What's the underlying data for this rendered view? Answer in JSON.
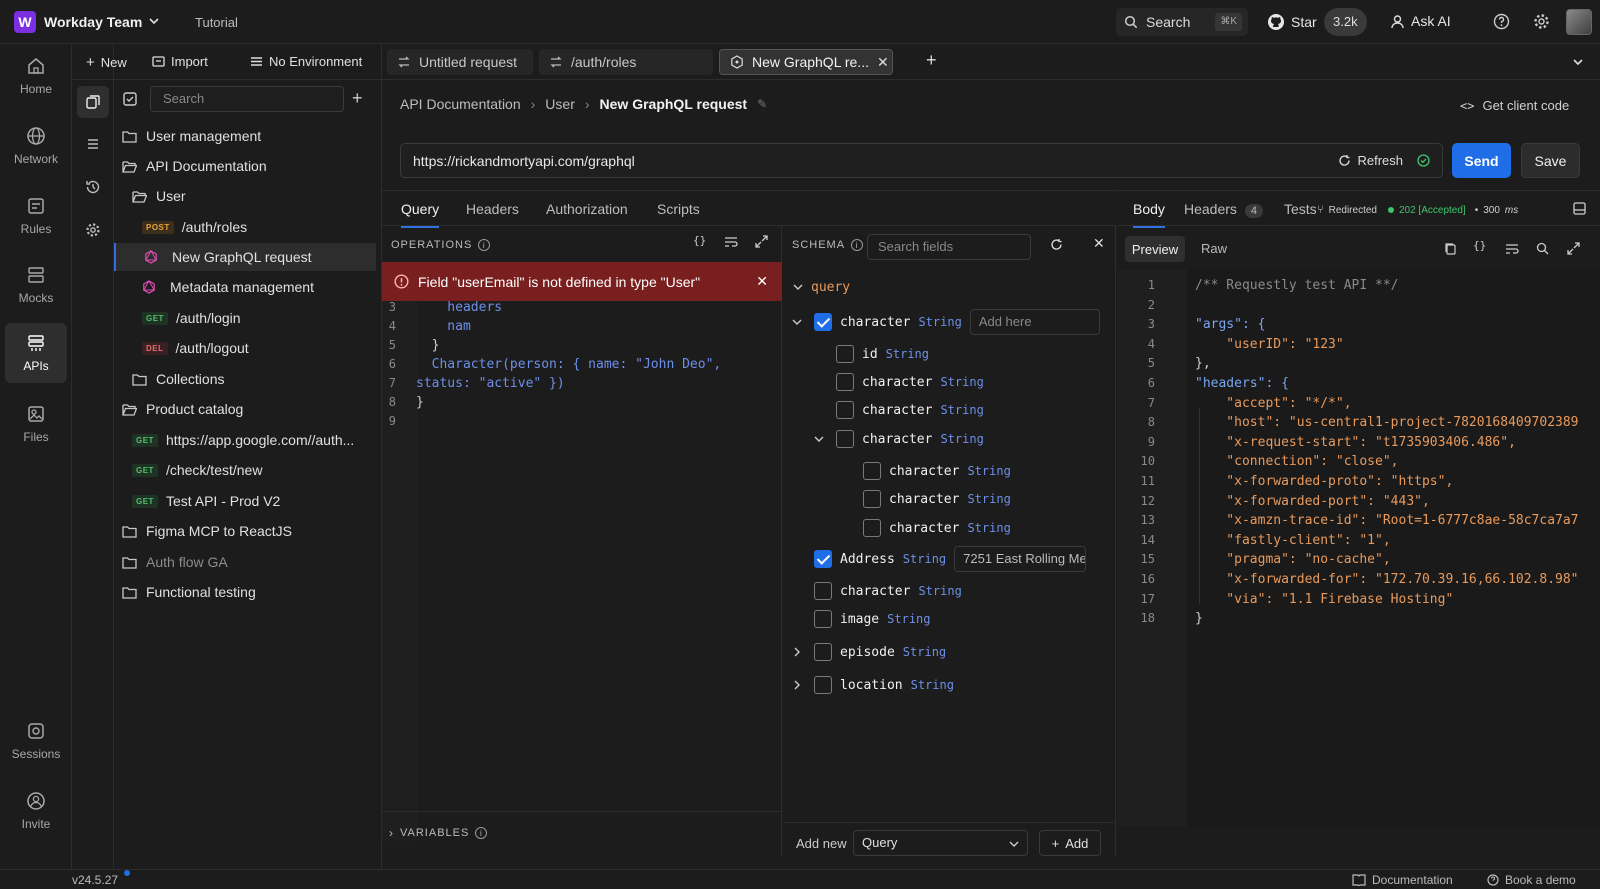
{
  "workspace": {
    "logo_letter": "W",
    "name": "Workday Team",
    "tutorial": "Tutorial"
  },
  "topbar": {
    "search_label": "Search",
    "search_shortcut": "⌘K",
    "star_label": "Star",
    "star_count": "3.2k",
    "ask_ai": "Ask AI"
  },
  "rail": [
    {
      "label": "Home",
      "icon": "home-icon"
    },
    {
      "label": "Network",
      "icon": "globe-icon"
    },
    {
      "label": "Rules",
      "icon": "rules-icon"
    },
    {
      "label": "Mocks",
      "icon": "mocks-icon"
    },
    {
      "label": "APIs",
      "icon": "apis-icon",
      "active": true
    },
    {
      "label": "Files",
      "icon": "files-icon"
    },
    {
      "label": "Sessions",
      "icon": "sessions-icon"
    },
    {
      "label": "Invite",
      "icon": "invite-icon"
    }
  ],
  "sidebar": {
    "new_label": "New",
    "import_label": "Import",
    "env_label": "No Environment",
    "search_placeholder": "Search",
    "tree": [
      {
        "label": "User management",
        "type": "folder",
        "depth": 0
      },
      {
        "label": "API Documentation",
        "type": "folder-open",
        "depth": 0
      },
      {
        "label": "User",
        "type": "folder-open",
        "depth": 1
      },
      {
        "label": "/auth/roles",
        "type": "request",
        "method": "POST",
        "depth": 2
      },
      {
        "label": "New GraphQL request",
        "type": "graphql",
        "depth": 2,
        "selected": true
      },
      {
        "label": "Metadata management",
        "type": "graphql",
        "depth": 2
      },
      {
        "label": "/auth/login",
        "type": "request",
        "method": "GET",
        "depth": 2
      },
      {
        "label": "/auth/logout",
        "type": "request",
        "method": "DEL",
        "depth": 2
      },
      {
        "label": "Collections",
        "type": "folder",
        "depth": 1
      },
      {
        "label": "Product catalog",
        "type": "folder-open",
        "depth": 0
      },
      {
        "label": "https://app.google.com//auth...",
        "type": "request",
        "method": "GET",
        "depth": 1
      },
      {
        "label": "/check/test/new",
        "type": "request",
        "method": "GET",
        "depth": 1
      },
      {
        "label": "Test API - Prod V2",
        "type": "request",
        "method": "GET",
        "depth": 1
      },
      {
        "label": "Figma MCP to ReactJS",
        "type": "folder",
        "depth": 0
      },
      {
        "label": "Auth flow GA",
        "type": "folder-special",
        "depth": 0,
        "dim": true
      },
      {
        "label": "Functional testing",
        "type": "folder",
        "depth": 0
      }
    ]
  },
  "tabs": [
    {
      "label": "Untitled request",
      "icon": "swap-icon"
    },
    {
      "label": "/auth/roles",
      "icon": "swap-icon"
    },
    {
      "label": "New GraphQL re...",
      "icon": "graphql-icon",
      "active": true
    }
  ],
  "breadcrumb": {
    "items": [
      "API Documentation",
      "User"
    ],
    "current": "New GraphQL request"
  },
  "client_code": "Get client code",
  "url": {
    "value": "https://rickandmortyapi.com/graphql",
    "refresh": "Refresh",
    "send": "Send",
    "save": "Save"
  },
  "request_tabs": [
    "Query",
    "Headers",
    "Authorization",
    "Scripts"
  ],
  "operations": {
    "title": "OPERATIONS",
    "error": "Field \"userEmail\" is not defined in type \"User\"",
    "lines": [
      {
        "n": "3",
        "text": "    headers"
      },
      {
        "n": "4",
        "text": "    nam"
      },
      {
        "n": "5",
        "text": "  }"
      },
      {
        "n": "6",
        "text": "  Character(person: { name: \"John Deo\","
      },
      {
        "n": "7",
        "text": "status: \"active\" })"
      },
      {
        "n": "8",
        "text": "}"
      },
      {
        "n": "9",
        "text": ""
      }
    ],
    "variables": "VARIABLES"
  },
  "schema": {
    "title": "SCHEMA",
    "search_placeholder": "Search fields",
    "root": "query",
    "fields": [
      {
        "name": "character",
        "type": "String",
        "checked": true,
        "expanded": true,
        "input_placeholder": "Add here"
      },
      {
        "name": "id",
        "type": "String"
      },
      {
        "name": "character",
        "type": "String"
      },
      {
        "name": "character",
        "type": "String"
      },
      {
        "name": "character",
        "type": "String",
        "expanded": true
      },
      {
        "name": "character",
        "type": "String"
      },
      {
        "name": "character",
        "type": "String"
      },
      {
        "name": "character",
        "type": "String"
      },
      {
        "name": "Address",
        "type": "String",
        "checked": true,
        "input_value": "7251 East Rolling Mea"
      },
      {
        "name": "character",
        "type": "String"
      },
      {
        "name": "image",
        "type": "String"
      },
      {
        "name": "episode",
        "type": "String",
        "collapsed": true
      },
      {
        "name": "location",
        "type": "String",
        "collapsed": true
      }
    ],
    "add_new": "Add new",
    "add_type": "Query",
    "add_button": "Add"
  },
  "response": {
    "tabs": [
      "Body",
      "Headers",
      "Tests"
    ],
    "headers_count": "4",
    "redirected": "Redirected",
    "status": "202 [Accepted]",
    "time": "300",
    "time_unit": "ms",
    "view_tabs": [
      "Preview",
      "Raw"
    ],
    "lines": [
      "/** Requestly test API **/",
      "",
      "\"args\": {",
      "    \"userID\": \"123\"",
      "},",
      "\"headers\": {",
      "    \"accept\": \"*/*\",",
      "    \"host\": \"us-central1-project-7820168409702389",
      "    \"x-request-start\": \"t1735903406.486\",",
      "    \"connection\": \"close\",",
      "    \"x-forwarded-proto\": \"https\",",
      "    \"x-forwarded-port\": \"443\",",
      "    \"x-amzn-trace-id\": \"Root=1-6777c8ae-58c7ca7a7",
      "    \"fastly-client\": \"1\",",
      "    \"pragma\": \"no-cache\",",
      "    \"x-forwarded-for\": \"172.70.39.16,66.102.8.98\"",
      "    \"via\": \"1.1 Firebase Hosting\"",
      "}"
    ]
  },
  "footer": {
    "version": "v24.5.27",
    "documentation": "Documentation",
    "book_demo": "Book a demo"
  },
  "colors": {
    "accent": "#1f6ee8",
    "error": "#7a1f1f",
    "brand": "#7b2fe0",
    "success": "#3ec46d"
  }
}
